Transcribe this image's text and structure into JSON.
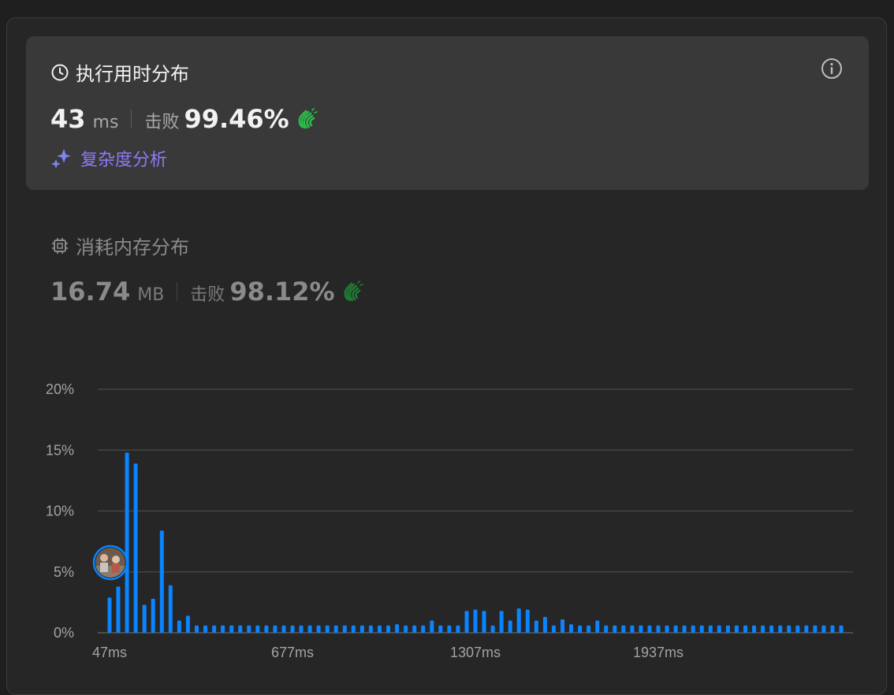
{
  "runtime": {
    "title": "执行用时分布",
    "value": "43",
    "unit": "ms",
    "beat_label": "击败",
    "beat_value": "99.46%",
    "complexity_label": "复杂度分析"
  },
  "memory": {
    "title": "消耗内存分布",
    "value": "16.74",
    "unit": "MB",
    "beat_label": "击败",
    "beat_value": "98.12%"
  },
  "icons": {
    "runtime": "clock-icon",
    "memory": "chip-icon",
    "info": "info-icon",
    "complexity": "sparkle-icon",
    "beat": "clapping-hands-icon",
    "marker": "user-avatar"
  },
  "colors": {
    "bar": "#0a84ff",
    "accent_purple": "#8c7bf7",
    "clap_green": "#2cbb4a",
    "clap_green_dim": "#1f7a33"
  },
  "chart_data": {
    "type": "bar",
    "y_ticks": [
      "20%",
      "15%",
      "10%",
      "5%",
      "0%"
    ],
    "x_tick_labels": [
      "47ms",
      "677ms",
      "1307ms",
      "1937ms"
    ],
    "ylim": [
      0,
      20
    ],
    "unit": "%",
    "grid": true,
    "marker_index": 0,
    "values": [
      2.9,
      3.8,
      14.8,
      13.9,
      2.3,
      2.8,
      8.4,
      3.9,
      1.0,
      1.4,
      0.6,
      0.6,
      0.6,
      0.6,
      0.6,
      0.6,
      0.6,
      0.6,
      0.6,
      0.6,
      0.6,
      0.6,
      0.6,
      0.6,
      0.6,
      0.6,
      0.6,
      0.6,
      0.6,
      0.6,
      0.6,
      0.6,
      0.6,
      0.7,
      0.6,
      0.6,
      0.6,
      1.0,
      0.6,
      0.6,
      0.6,
      1.8,
      1.9,
      1.8,
      0.6,
      1.8,
      1.0,
      2.0,
      1.9,
      1.0,
      1.3,
      0.6,
      1.1,
      0.7,
      0.6,
      0.6,
      1.0,
      0.6,
      0.6,
      0.6,
      0.6,
      0.6,
      0.6,
      0.6,
      0.6,
      0.6,
      0.6,
      0.6,
      0.6,
      0.6,
      0.6,
      0.6,
      0.6,
      0.6,
      0.6,
      0.6,
      0.6,
      0.6,
      0.6,
      0.6,
      0.6,
      0.6,
      0.6,
      0.6,
      0.6
    ]
  }
}
